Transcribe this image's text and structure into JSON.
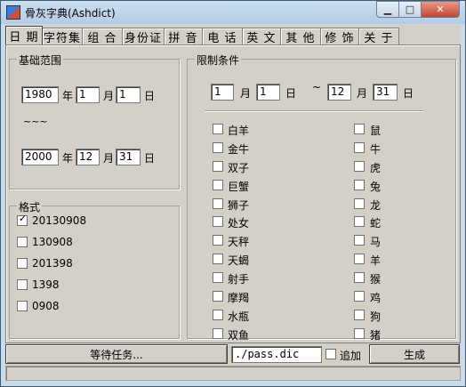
{
  "window": {
    "title": "骨灰字典(Ashdict)"
  },
  "tabs": [
    "日 期",
    "字符集",
    "组 合",
    "身份证",
    "拼 音",
    "电 话",
    "英 文",
    "其 他",
    "修 饰",
    "关 于"
  ],
  "base_range": {
    "title": "基础范围",
    "start": {
      "year": "1980",
      "month": "1",
      "day": "1"
    },
    "separator": "~~~",
    "end": {
      "year": "2000",
      "month": "12",
      "day": "31"
    },
    "unit_year": "年",
    "unit_month": "月",
    "unit_day": "日"
  },
  "format": {
    "title": "格式",
    "items": [
      {
        "label": "20130908",
        "checked": true
      },
      {
        "label": "130908",
        "checked": false
      },
      {
        "label": "201398",
        "checked": false
      },
      {
        "label": "1398",
        "checked": false
      },
      {
        "label": "0908",
        "checked": false
      }
    ]
  },
  "limits": {
    "title": "限制条件",
    "from": {
      "month": "1",
      "day": "1"
    },
    "to": {
      "month": "12",
      "day": "31"
    },
    "tilde": "~",
    "unit_month": "月",
    "unit_day": "日",
    "zodiac_signs": [
      "白羊",
      "金牛",
      "双子",
      "巨蟹",
      "狮子",
      "处女",
      "天秤",
      "天蝎",
      "射手",
      "摩羯",
      "水瓶",
      "双鱼"
    ],
    "chinese_zodiac": [
      "鼠",
      "牛",
      "虎",
      "兔",
      "龙",
      "蛇",
      "马",
      "羊",
      "猴",
      "鸡",
      "狗",
      "猪"
    ]
  },
  "status": {
    "task_label": "等待任务...",
    "output_path": "./pass.dic",
    "append_label": "追加",
    "generate_label": "生成"
  }
}
